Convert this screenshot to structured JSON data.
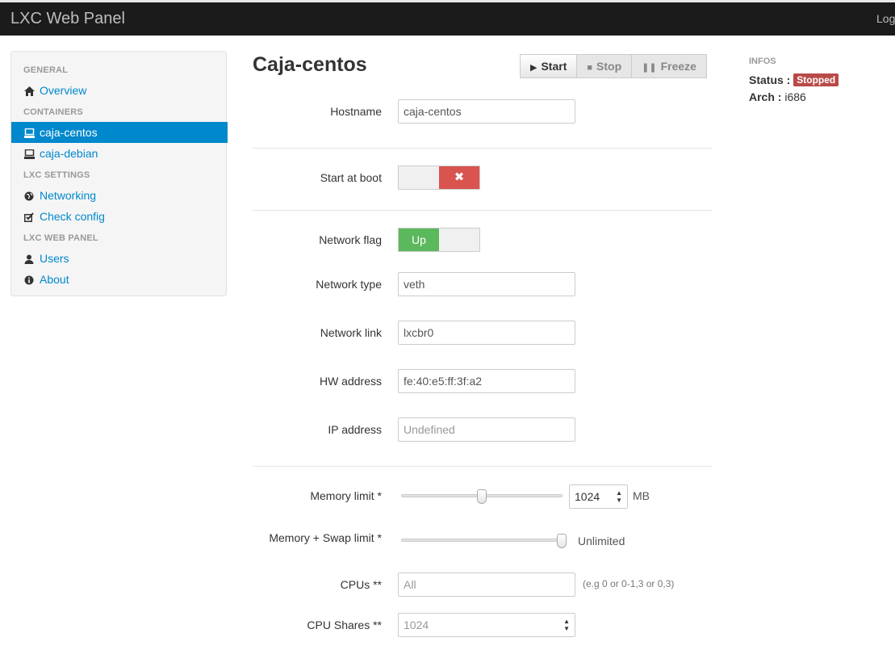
{
  "app": {
    "brand": "LXC Web Panel",
    "logout_label": "Log"
  },
  "sidebar": {
    "headers": [
      "GENERAL",
      "CONTAINERS",
      "LXC SETTINGS",
      "LXC WEB PANEL"
    ],
    "items": [
      {
        "label": "Overview",
        "icon": "home-icon"
      },
      {
        "label": "caja-centos",
        "icon": "container-icon",
        "active": true
      },
      {
        "label": "caja-debian",
        "icon": "container-icon"
      },
      {
        "label": "Networking",
        "icon": "globe-icon"
      },
      {
        "label": "Check config",
        "icon": "check-icon"
      },
      {
        "label": "Users",
        "icon": "user-icon"
      },
      {
        "label": "About",
        "icon": "info-icon"
      }
    ]
  },
  "page": {
    "title": "Caja-centos"
  },
  "actions": {
    "start": "Start",
    "stop": "Stop",
    "freeze": "Freeze"
  },
  "form": {
    "hostname": {
      "label": "Hostname",
      "value": "caja-centos"
    },
    "start_at_boot": {
      "label": "Start at boot",
      "state": "off",
      "off_glyph": "✖"
    },
    "network_flag": {
      "label": "Network flag",
      "state": "on",
      "on_label": "Up"
    },
    "network_type": {
      "label": "Network type",
      "value": "veth"
    },
    "network_link": {
      "label": "Network link",
      "value": "lxcbr0"
    },
    "hw_address": {
      "label": "HW address",
      "value": "fe:40:e5:ff:3f:a2"
    },
    "ip_address": {
      "label": "IP address",
      "placeholder": "Undefined"
    },
    "memory_limit": {
      "label": "Memory limit *",
      "value": "1024",
      "unit": "MB"
    },
    "memory_swap_limit": {
      "label": "Memory + Swap limit *",
      "value_text": "Unlimited"
    },
    "cpus": {
      "label": "CPUs **",
      "placeholder": "All",
      "help": "(e.g 0 or 0-1,3 or 0,3)"
    },
    "cpu_shares": {
      "label": "CPU Shares **",
      "placeholder": "1024"
    }
  },
  "infos": {
    "heading": "INFOS",
    "status_label": "Status :",
    "status_value": "Stopped",
    "status_color": "#b94a48",
    "arch_label": "Arch :",
    "arch_value": "i686"
  }
}
